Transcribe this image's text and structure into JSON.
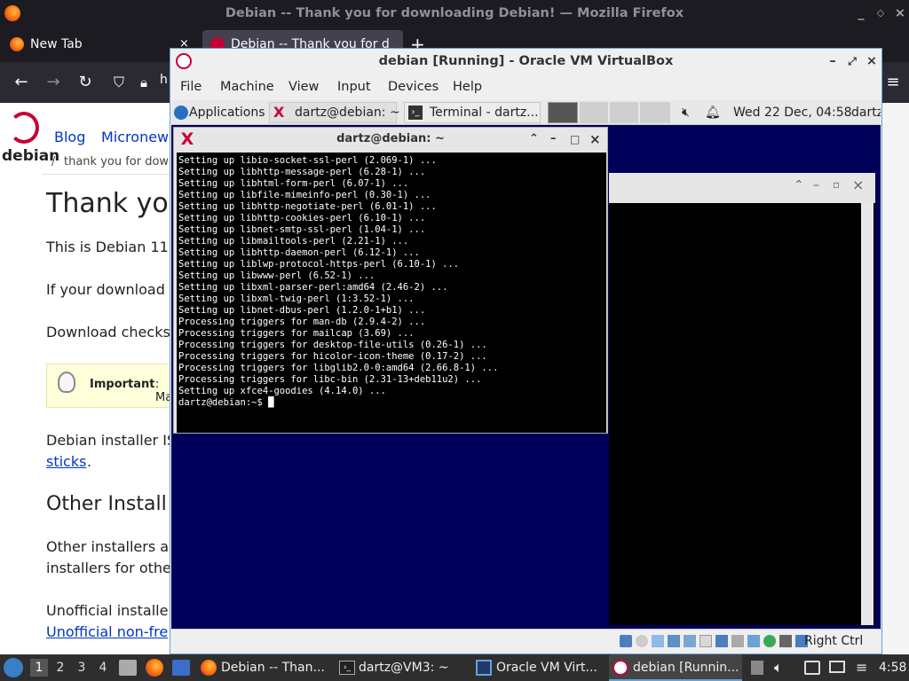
{
  "firefox": {
    "window_title": "Debian -- Thank you for downloading Debian! — Mozilla Firefox",
    "tabs": [
      {
        "label": "New Tab",
        "close": "×"
      },
      {
        "label": "Debian -- Thank you for d",
        "close": "×"
      }
    ],
    "new_tab": "+",
    "url_fragment": "h",
    "page": {
      "logo_text": "debian",
      "nav": [
        "Blog",
        "Micronew"
      ],
      "breadcrumb_sep": "/",
      "breadcrumb": "thank you for downl",
      "heading": "Thank you",
      "p1": "This is Debian 11",
      "p2": "If your download",
      "p3": "Download checks",
      "important_label": "Important",
      "important_rest": ": Ma",
      "p4_line1": "Debian installer IS",
      "p4_link": "sticks",
      "p4_tail": ".",
      "heading2": "Other Install",
      "p5_line1": "Other installers a",
      "p5_line2": "installers for othe",
      "p6_line1": "Unofficial installe",
      "p6_link": "Unofficial non-fre"
    }
  },
  "vbox": {
    "title": "debian [Running] - Oracle VM VirtualBox",
    "menu": [
      "File",
      "Machine",
      "View",
      "Input",
      "Devices",
      "Help"
    ],
    "status_hostkey": "Right Ctrl",
    "guest": {
      "panel": {
        "applications": "Applications",
        "task1": "dartz@debian: ~",
        "task2": "Terminal - dartz...",
        "clock": "Wed 22 Dec, 04:58",
        "user": "dartz"
      },
      "terminal": {
        "title": "dartz@debian: ~",
        "lines": [
          "Setting up libio-socket-ssl-perl (2.069-1) ...",
          "Setting up libhttp-message-perl (6.28-1) ...",
          "Setting up libhtml-form-perl (6.07-1) ...",
          "Setting up libfile-mimeinfo-perl (0.30-1) ...",
          "Setting up libhttp-negotiate-perl (6.01-1) ...",
          "Setting up libhttp-cookies-perl (6.10-1) ...",
          "Setting up libnet-smtp-ssl-perl (1.04-1) ...",
          "Setting up libmailtools-perl (2.21-1) ...",
          "Setting up libhttp-daemon-perl (6.12-1) ...",
          "Setting up liblwp-protocol-https-perl (6.10-1) ...",
          "Setting up libwww-perl (6.52-1) ...",
          "Setting up libxml-parser-perl:amd64 (2.46-2) ...",
          "Setting up libxml-twig-perl (1:3.52-1) ...",
          "Setting up libnet-dbus-perl (1.2.0-1+b1) ...",
          "Processing triggers for man-db (2.9.4-2) ...",
          "Processing triggers for mailcap (3.69) ...",
          "Processing triggers for desktop-file-utils (0.26-1) ...",
          "Processing triggers for hicolor-icon-theme (0.17-2) ...",
          "Processing triggers for libglib2.0-0:amd64 (2.66.8-1) ...",
          "Processing triggers for libc-bin (2.31-13+deb11u2) ...",
          "Setting up xfce4-goodies (4.14.0) ...",
          "dartz@debian:~$ █"
        ]
      }
    }
  },
  "taskbar": {
    "workspaces": [
      "1",
      "2",
      "3",
      "4"
    ],
    "tasks": [
      {
        "label": "Debian -- Than...",
        "icon": "firefox-icon"
      },
      {
        "label": "dartz@VM3: ~",
        "icon": "terminal-icon"
      },
      {
        "label": "Oracle VM Virt...",
        "icon": "virtualbox-icon"
      },
      {
        "label": "debian [Runnin...",
        "icon": "virtualbox-icon"
      }
    ],
    "clock": "4:58"
  },
  "colors": {
    "firefox_bg": "#1c1b22",
    "guest_desktop": "#00005a",
    "vbox_border": "#6aa0d8",
    "link": "#0035c7"
  }
}
